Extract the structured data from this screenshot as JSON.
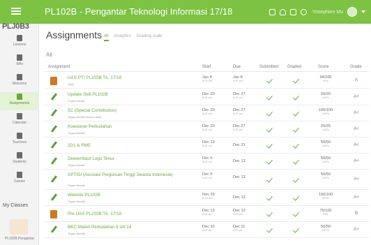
{
  "header": {
    "course_title": "PL102B - Pengantar Teknologi Informasi 17/18",
    "user_name": "Yosephine Mu"
  },
  "sidebar": {
    "logo": "PLJ0B3",
    "items": [
      {
        "label": "Lessons"
      },
      {
        "label": "Wiki"
      },
      {
        "label": "Welcome"
      },
      {
        "label": "Assignments"
      },
      {
        "label": "Calendar"
      },
      {
        "label": "Teachers"
      },
      {
        "label": "Students"
      },
      {
        "label": "Games"
      }
    ],
    "active_index": 3,
    "my_classes_label": "My Classes",
    "course_tile_label": "PL102B Pengantar"
  },
  "page": {
    "title": "Assignments",
    "tabs": [
      "All",
      "Analytics",
      "Grading scale"
    ],
    "filter_label": "All"
  },
  "table": {
    "headers": [
      "Assignment",
      "Start",
      "Due",
      "Submitted",
      "Graded",
      "Score",
      "Grade"
    ],
    "rows": [
      {
        "icon": "doc",
        "title": "UAS PTI PL102B TA. 17/18",
        "subtitle": "Ujian",
        "start": "Jan 4",
        "start_time": "8:00 am",
        "due": "Jan 8",
        "due_time": "8:00 pm",
        "submitted": true,
        "graded": true,
        "score": "94/100",
        "percent": "94%",
        "grade": "A"
      },
      {
        "icon": "pencil",
        "title": "Update Skill PL102B",
        "subtitle": "Tugas Mandiri",
        "start": "Dec 20",
        "start_time": "8:00 am",
        "due": "Dec 27",
        "due_time": "8:00 pm",
        "submitted": true,
        "graded": true,
        "score": "20/20",
        "percent": "100%",
        "grade": "A+"
      },
      {
        "icon": "pencil",
        "title": "5C (Special Contribution)",
        "subtitle": "Tugas Mandiri (bonus nilai)",
        "start": "Dec 20",
        "start_time": "8:00 am",
        "due": "Dec 27",
        "due_time": "8:00 pm",
        "submitted": true,
        "graded": true,
        "score": "100/100",
        "percent": "100%",
        "grade": "A+"
      },
      {
        "icon": "pencil",
        "title": "Kuesioner Perkuliahan",
        "subtitle": "Tugas Mandiri",
        "start": "Dec 20",
        "start_time": "8:00 am",
        "due": "Dec 27",
        "due_time": "8:00 pm",
        "submitted": true,
        "graded": true,
        "score": "25/25",
        "percent": "100%",
        "grade": "A+"
      },
      {
        "icon": "pencil",
        "title": "2D1 & RME",
        "subtitle": "",
        "start": "Dec 13",
        "start_time": "8:00 am",
        "due": "Dec 21",
        "due_time": "",
        "submitted": true,
        "graded": true,
        "score": "50/50",
        "percent": "100%",
        "grade": "A+"
      },
      {
        "icon": "pencil",
        "title": "Dewembaut Logo Tenur",
        "subtitle": "Tugas Mandiri",
        "start": "Dec 6",
        "start_time": "8:00 am",
        "due": "Dec 13",
        "due_time": "",
        "submitted": true,
        "graded": true,
        "score": "50/50",
        "percent": "100%",
        "grade": "A+"
      },
      {
        "icon": "pencil",
        "title": "APTISI (Asosiasi Perguruan Tinggi Swasta Indonesia)",
        "subtitle": "Tugas Mandiri",
        "start": "Dec 6",
        "start_time": "8:00 am",
        "due": "Dec 13",
        "due_time": "",
        "submitted": true,
        "graded": true,
        "score": "50/50",
        "percent": "100%",
        "grade": "A+"
      },
      {
        "icon": "pencil",
        "title": "Website PL102B",
        "subtitle": "Tugas Mandiri",
        "start": "Nov 29",
        "start_time": "8:00 am",
        "due": "Dec 13",
        "due_time": "",
        "submitted": true,
        "graded": true,
        "score": "100/100",
        "percent": "100%",
        "grade": "A+"
      },
      {
        "icon": "doc",
        "title": "Pre UAS PL102B TA. 17/18",
        "subtitle": "",
        "start": "Dec 13",
        "start_time": "8:00 am",
        "due": "Dec 13",
        "due_time": "8:00 pm",
        "submitted": true,
        "graded": true,
        "score": "75/100",
        "percent": "75%",
        "grade": "B"
      },
      {
        "icon": "pencil",
        "title": "BKC Materi Perkuliahan 8 s/d 14",
        "subtitle": "Tugas Mandiri",
        "start": "Dec 10",
        "start_time": "8:00 am",
        "due": "Dec 11",
        "due_time": "8:00 pm",
        "submitted": true,
        "graded": true,
        "score": "50/50",
        "percent": "100%",
        "grade": "A+"
      }
    ]
  },
  "colors": {
    "brand_green": "#7dc242",
    "link_green": "#6aaa35",
    "exam_orange": "#d07a1f"
  }
}
